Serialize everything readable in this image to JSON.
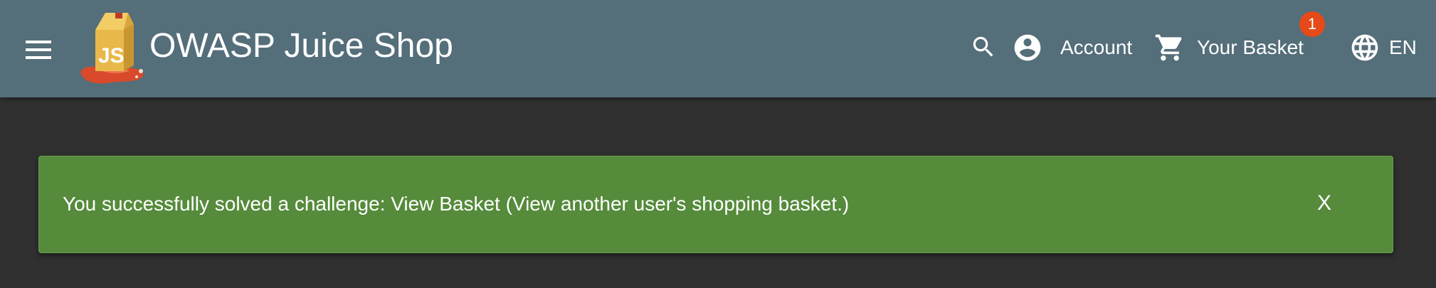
{
  "toolbar": {
    "menu_icon": "hamburger-menu-icon",
    "app_name": "OWASP Juice Shop",
    "logo_icon": "juice-box-logo-icon",
    "search_icon": "search-icon",
    "account_label": "Account",
    "account_icon": "account-circle-icon",
    "basket_label": "Your Basket",
    "basket_icon": "shopping-cart-icon",
    "basket_count": "1",
    "language_label": "EN",
    "language_icon": "globe-icon"
  },
  "notification": {
    "message": "You successfully solved a challenge: View Basket (View another user's shopping basket.)",
    "close_label": "X"
  },
  "colors": {
    "toolbar": "#546e7a",
    "background": "#303030",
    "success": "#558b3b",
    "badge": "#e64a19"
  }
}
